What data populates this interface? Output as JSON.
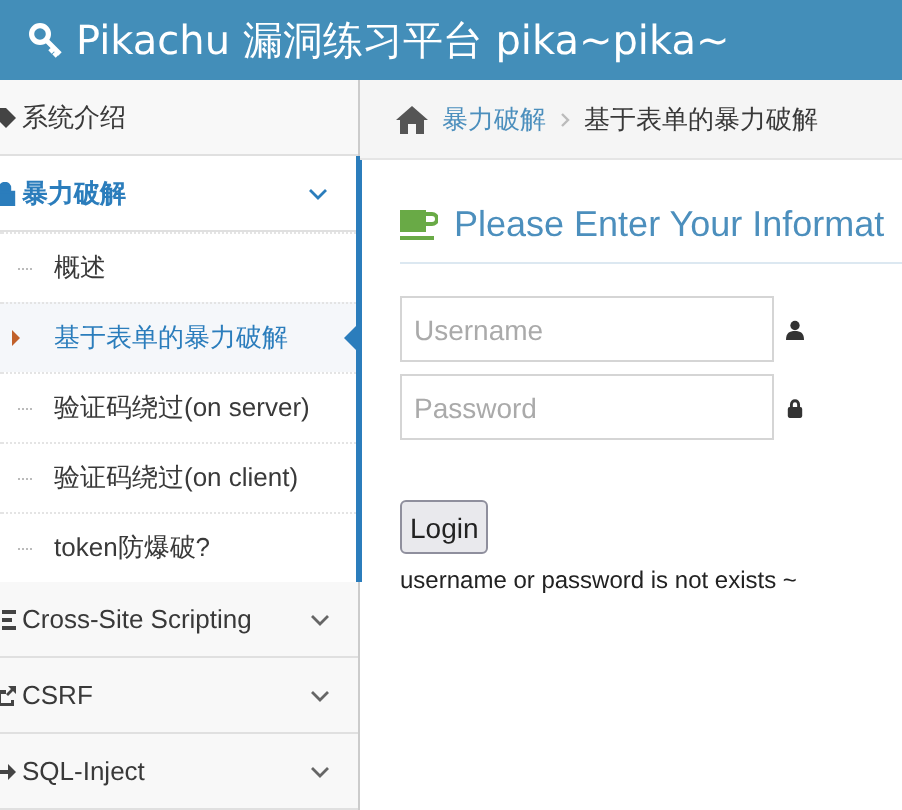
{
  "header": {
    "title": "Pikachu 漏洞练习平台 pika~pika~"
  },
  "sidebar": {
    "items": [
      {
        "label": "系统介绍",
        "kind": "tag",
        "expandable": false,
        "expanded": false
      },
      {
        "label": "暴力破解",
        "kind": "lock",
        "expandable": true,
        "expanded": true,
        "children": [
          {
            "label": "概述",
            "selected": false
          },
          {
            "label": "基于表单的暴力破解",
            "selected": true
          },
          {
            "label": "验证码绕过(on server)",
            "selected": false
          },
          {
            "label": "验证码绕过(on client)",
            "selected": false
          },
          {
            "label": "token防爆破?",
            "selected": false
          }
        ]
      },
      {
        "label": "Cross-Site Scripting",
        "kind": "list",
        "expandable": true,
        "expanded": false
      },
      {
        "label": "CSRF",
        "kind": "share",
        "expandable": true,
        "expanded": false
      },
      {
        "label": "SQL-Inject",
        "kind": "arrow",
        "expandable": true,
        "expanded": false
      }
    ]
  },
  "breadcrumb": [
    {
      "label": "暴力破解",
      "kind": "link"
    },
    {
      "label": "基于表单的暴力破解",
      "kind": "current"
    }
  ],
  "form": {
    "title": "Please Enter Your Informat",
    "fields": [
      {
        "placeholder": "Username",
        "kind": "user"
      },
      {
        "placeholder": "Password",
        "kind": "lock"
      }
    ],
    "button": "Login",
    "message": "username or password is not exists ~"
  }
}
